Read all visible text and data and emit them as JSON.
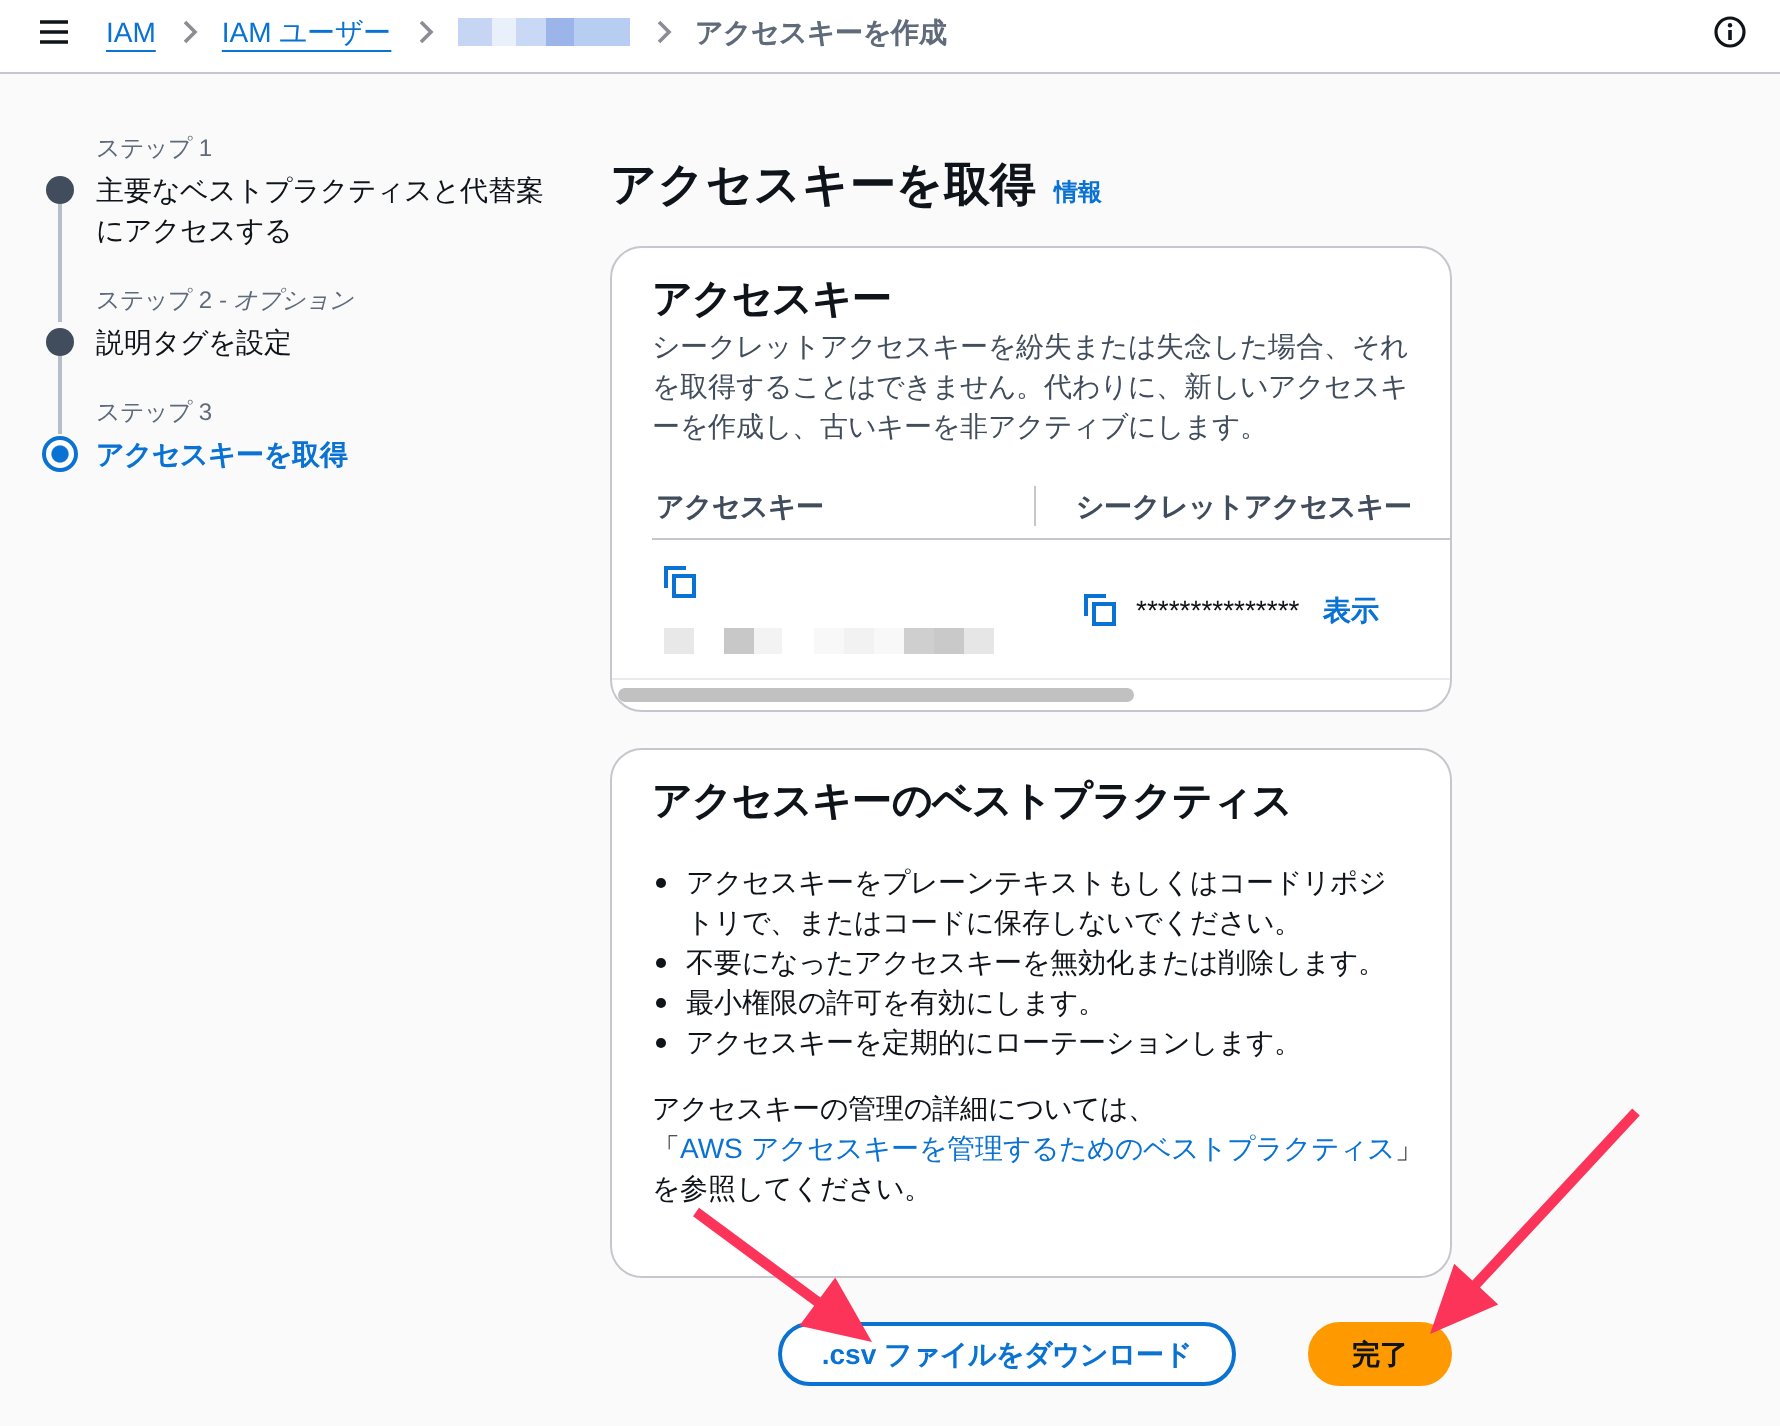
{
  "top_bar": {
    "breadcrumbs": [
      {
        "kind": "link",
        "label": "IAM"
      },
      {
        "kind": "link",
        "label": "IAM ユーザー"
      },
      {
        "kind": "redacted"
      },
      {
        "kind": "current",
        "label": "アクセスキーを作成"
      }
    ]
  },
  "steps": [
    {
      "label": "ステップ 1",
      "title": "主要なベストプラクティスと代替案にアクセスする",
      "selected": false
    },
    {
      "label": "ステップ 2 *- オプション*",
      "title": "説明タグを設定",
      "selected": false
    },
    {
      "label": "ステップ 3",
      "title": "アクセスキーを取得",
      "selected": true
    }
  ],
  "page": {
    "title": "アクセスキーを取得",
    "info_link": "情報"
  },
  "access_key_card": {
    "title": "アクセスキー",
    "description": "シークレットアクセスキーを紛失または失念した場合、それを取得することはできません。代わりに、新しいアクセスキーを作成し、古いキーを非アクティブにします。",
    "columns": [
      "アクセスキー",
      "シークレットアクセスキー"
    ],
    "row": {
      "access_key": {
        "kind": "redacted"
      },
      "secret_access_key": "***************",
      "show_link": "表示"
    }
  },
  "best_practices_card": {
    "title": "アクセスキーのベストプラクティス",
    "bullets": [
      "アクセスキーをプレーンテキストもしくはコードリポジトリで、またはコードに保存しないでください。",
      "不要になったアクセスキーを無効化または削除します。",
      "最小権限の許可を有効にします。",
      "アクセスキーを定期的にローテーションします。"
    ],
    "note": {
      "before": "アクセスキーの管理の詳細については、「",
      "link": "AWS アクセスキーを管理するためのベストプラクティス",
      "after": "」を参照してください。"
    }
  },
  "buttons": [
    {
      "kind": "secondary",
      "label": ".csv ファイルをダウンロード",
      "pointer_arrow": true
    },
    {
      "kind": "primary",
      "label": "完了",
      "pointer_arrow": true
    }
  ]
}
